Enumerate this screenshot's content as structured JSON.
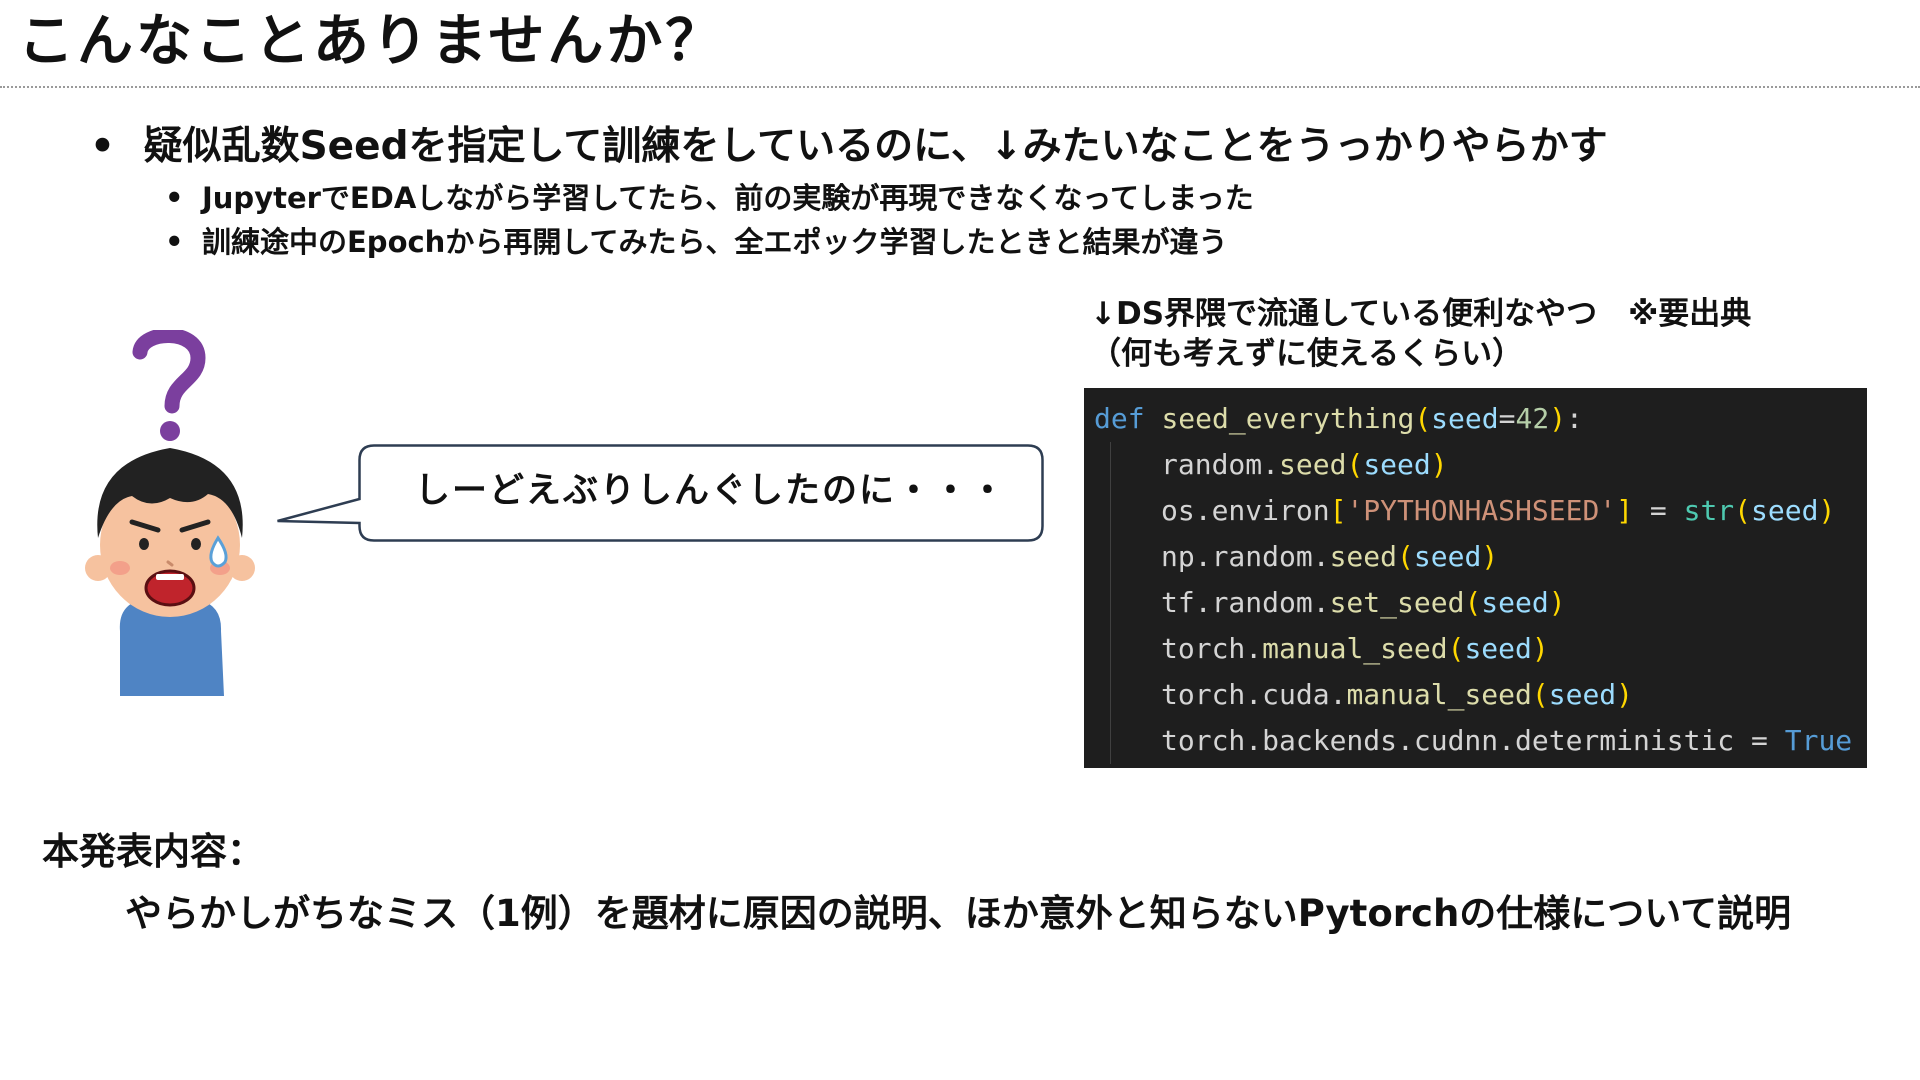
{
  "slide": {
    "title": "こんなことありませんか？",
    "bullets": {
      "main": "疑似乱数Seedを指定して訓練をしているのに、↓みたいなことをうっかりやらかす",
      "sub": [
        "JupyterでEDAしながら学習してたら、前の実験が再現できなくなってしまった",
        "訓練途中のEpochから再開してみたら、全エポック学習したときと結果が違う"
      ]
    },
    "speech_bubble": "しーどえぶりしんぐしたのに・・・",
    "snippet_caption": {
      "line1": "↓DS界隈で流通している便利なやつ　※要出典",
      "line2": "（何も考えずに使えるくらい）"
    },
    "code": {
      "def_keyword": "def",
      "function_name": "seed_everything",
      "param_name": "seed",
      "param_default": "42",
      "lines": [
        {
          "obj": "random.",
          "fn": "seed",
          "arg": "seed"
        },
        {
          "obj": "np.random.",
          "fn": "seed",
          "arg": "seed"
        },
        {
          "obj": "tf.random.",
          "fn": "set_seed",
          "arg": "seed"
        },
        {
          "obj": "torch.",
          "fn": "manual_seed",
          "arg": "seed"
        },
        {
          "obj": "torch.cuda.",
          "fn": "manual_seed",
          "arg": "seed"
        }
      ],
      "environ": {
        "obj": "os.environ",
        "key": "'PYTHONHASHSEED'",
        "builtin": "str",
        "arg": "seed"
      },
      "last_line": {
        "target": "torch.backends.cudnn.deterministic",
        "value": "True"
      }
    },
    "summary": {
      "label": "本発表内容：",
      "text": "やらかしがちなミス（1例）を題材に原因の説明、ほか意外と知らないPytorchの仕様について説明"
    },
    "colors": {
      "code_background": "#1e1e1e",
      "keyword": "#569cd6",
      "function": "#dcdcaa",
      "parameter": "#9cdcfe",
      "number": "#b5cea8",
      "string": "#ce9178",
      "builtin": "#4ec9b0",
      "bracket": "#ffd700",
      "question_mark": "#7b3f9e",
      "shirt": "#4f84c4"
    },
    "icons": [
      "question-mark-icon",
      "worried-boy-illustration",
      "sweat-drop-icon"
    ]
  }
}
